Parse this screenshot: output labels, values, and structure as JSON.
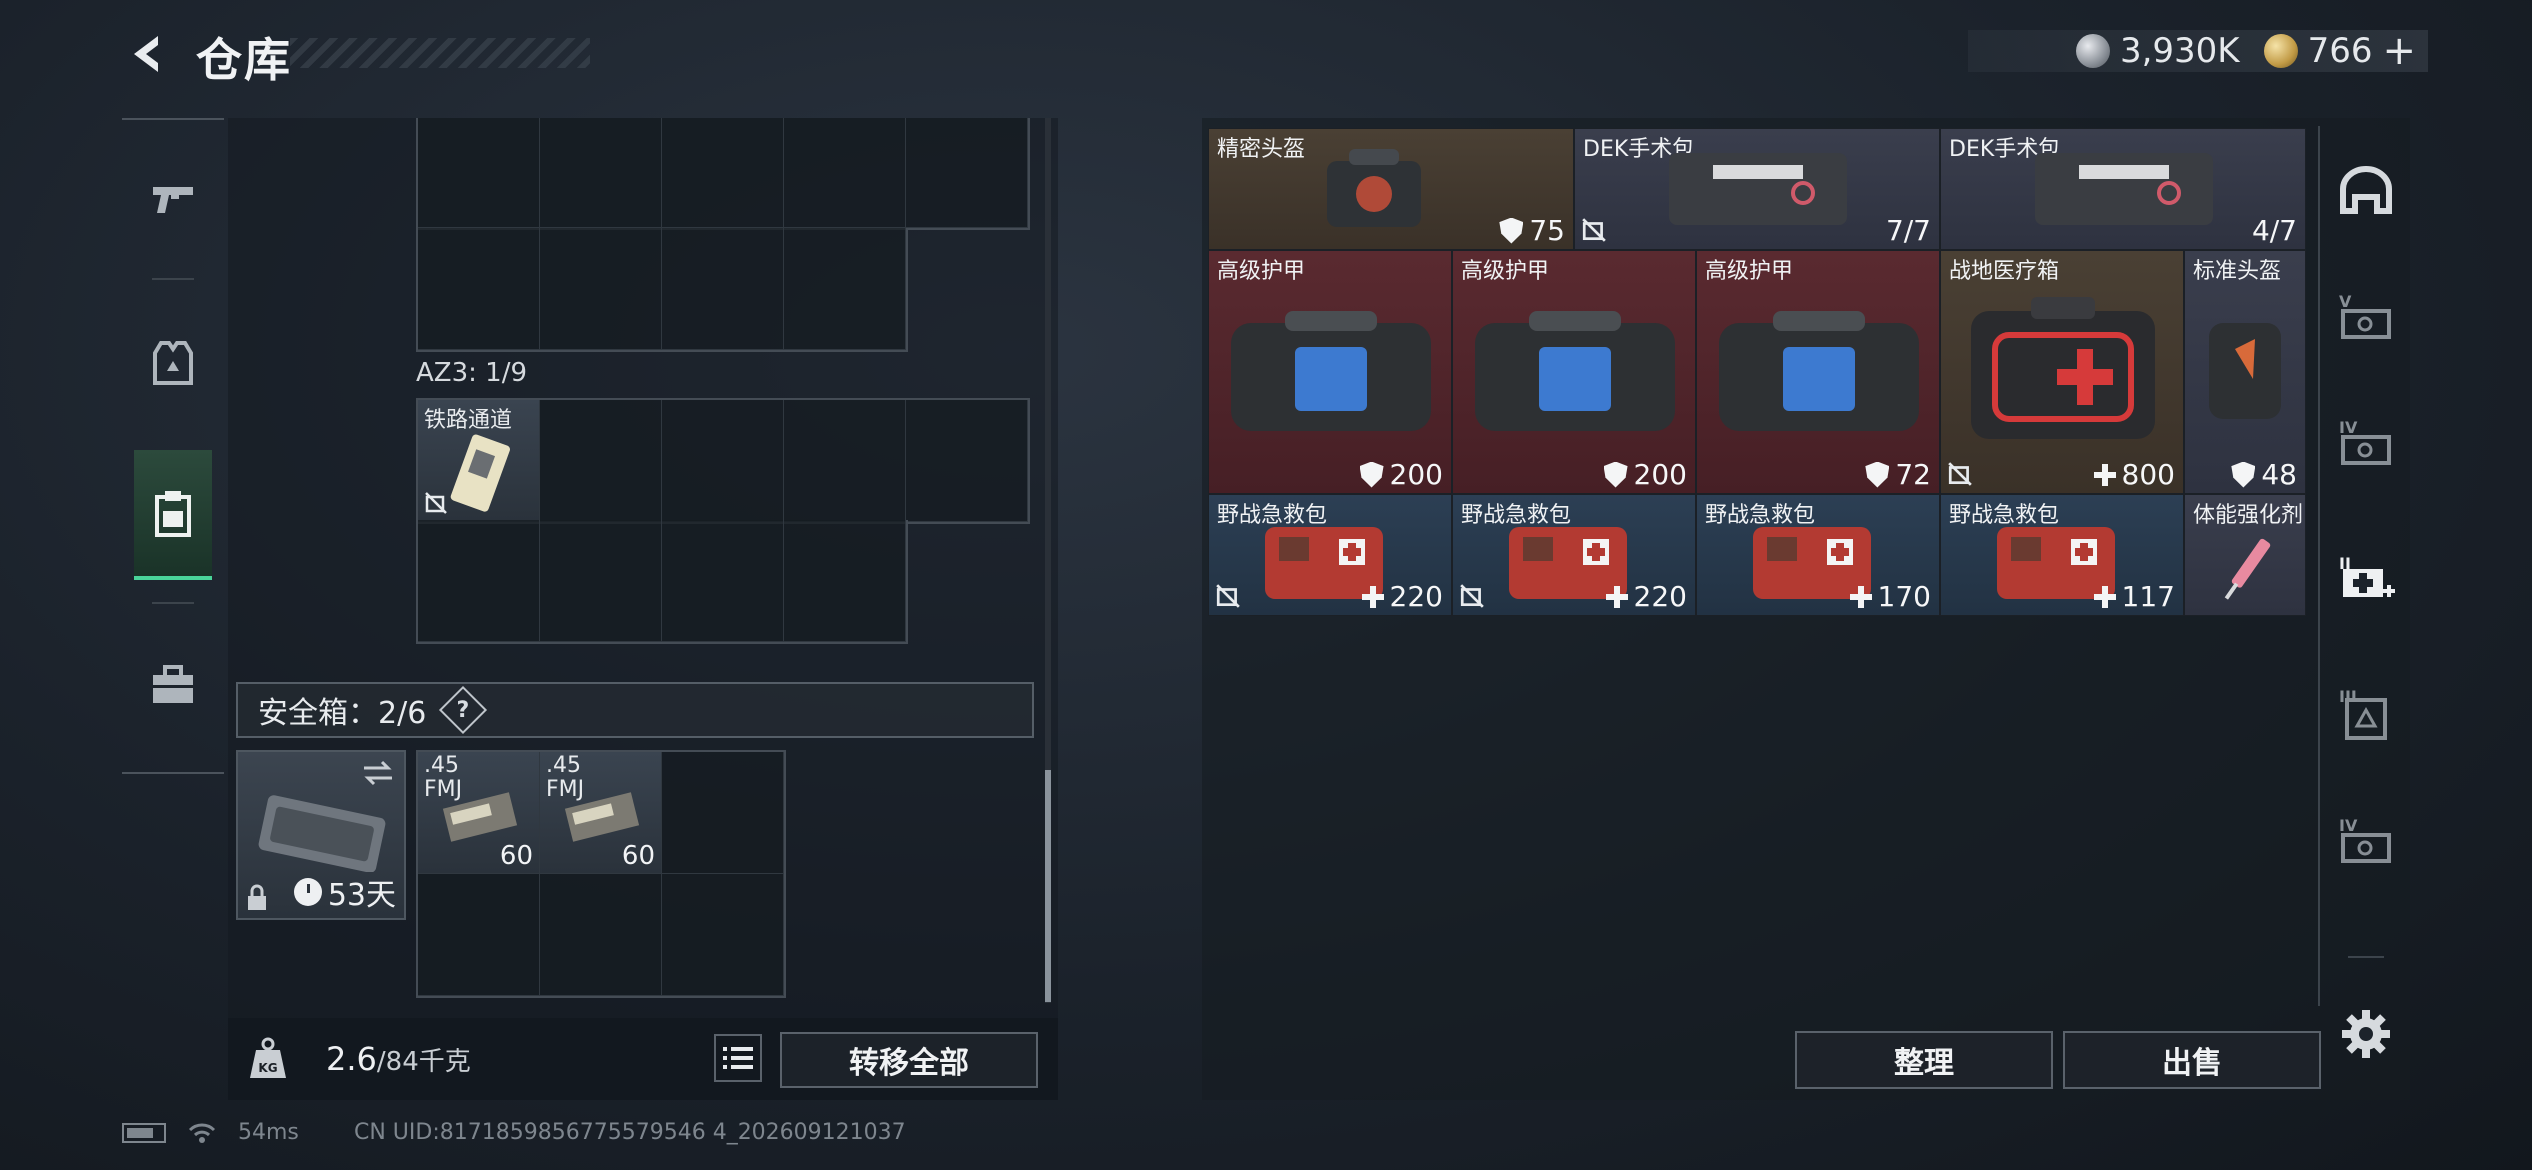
{
  "header": {
    "title": "仓库",
    "currency_silver": "3,930K",
    "currency_gold": "766",
    "add_label": "+"
  },
  "left": {
    "az_label": "AZ3: 1/9",
    "railway_item": {
      "label": "铁路通道"
    },
    "safebox_title": "安全箱：2/6",
    "help": "?",
    "safebox_days": "53天",
    "ammo": [
      {
        "label": ".45\nFMJ",
        "count": "60"
      },
      {
        "label": ".45\nFMJ",
        "count": "60"
      }
    ],
    "weight_value": "2.6",
    "weight_max": "/84千克",
    "transfer_label": "转移全部"
  },
  "right": {
    "items": [
      {
        "label": "精密头盔",
        "value": "75",
        "icon": "shield"
      },
      {
        "label": "DEK手术包",
        "value": "7/7"
      },
      {
        "label": "DEK手术包",
        "value": "4/7"
      },
      {
        "label": "高级护甲",
        "value": "200",
        "icon": "shield"
      },
      {
        "label": "高级护甲",
        "value": "200",
        "icon": "shield"
      },
      {
        "label": "高级护甲",
        "value": "72",
        "icon": "shield"
      },
      {
        "label": "战地医疗箱",
        "value": "800",
        "icon": "cross"
      },
      {
        "label": "标准头盔",
        "value": "48",
        "icon": "shield"
      },
      {
        "label": "野战急救包",
        "value": "220",
        "icon": "cross"
      },
      {
        "label": "野战急救包",
        "value": "220",
        "icon": "cross"
      },
      {
        "label": "野战急救包",
        "value": "170",
        "icon": "cross"
      },
      {
        "label": "野战急救包",
        "value": "117",
        "icon": "cross"
      },
      {
        "label": "体能强化剂",
        "value": "",
        "icon": ""
      }
    ],
    "sort_label": "整理",
    "sell_label": "出售"
  },
  "status": {
    "ping": "54ms",
    "uid": "CN UID:8171859856775579546 4_202609121037"
  },
  "colors": {
    "accent": "#4ad49a",
    "armor_bg": "#5a2a30",
    "med_bg": "#2c3f54"
  }
}
